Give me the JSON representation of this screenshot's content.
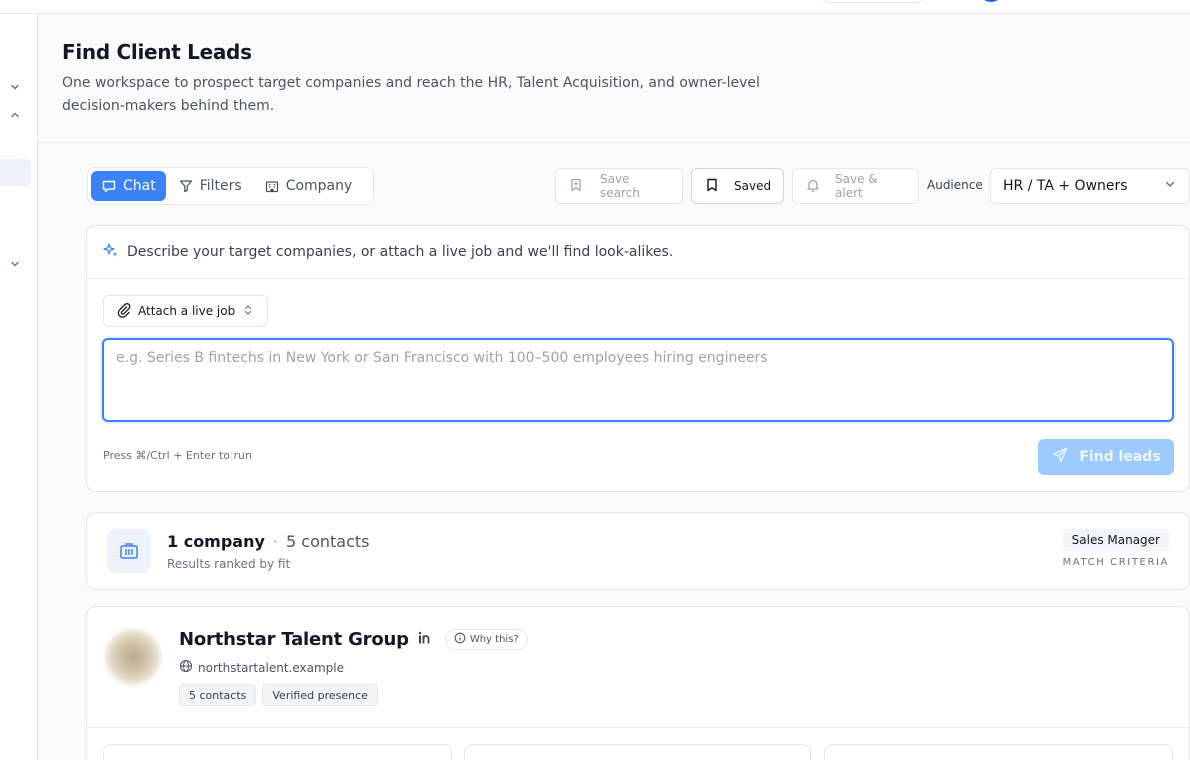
{
  "header": {
    "title": "Find Client Leads",
    "subtitle": "One workspace to prospect target companies and reach the HR, Talent Acquisition, and owner-level decision-makers behind them."
  },
  "mode_tabs": [
    {
      "label": "Chat",
      "icon": "chat-icon",
      "active": true
    },
    {
      "label": "Filters",
      "icon": "filter-icon",
      "active": false
    },
    {
      "label": "Company",
      "icon": "building-icon",
      "active": false
    }
  ],
  "toolbar": {
    "save_search_label": "Save search",
    "saved_label": "Saved",
    "save_alert_label": "Save & alert",
    "audience_label": "Audience",
    "audience_value": "HR / TA + Owners"
  },
  "prompt": {
    "heading": "Describe your target companies, or attach a live job and we'll find look-alikes.",
    "attach_label": "Attach a live job",
    "placeholder": "e.g. Series B fintechs in New York or San Francisco with 100–500 employees hiring engineers",
    "value": "",
    "shortcut_hint": "Press ⌘/Ctrl + Enter to run",
    "submit_label": "Find leads"
  },
  "summary": {
    "companies": "1 company",
    "separator": "·",
    "contacts": "5 contacts",
    "subtitle": "Results ranked by fit",
    "criteria_badge": "Sales Manager",
    "criteria_label": "MATCH CRITERIA"
  },
  "company": {
    "name": "Northstar Talent Group",
    "why_label": "Why this?",
    "domain": "northstartalent.example",
    "tags": [
      "5 contacts",
      "Verified presence"
    ]
  },
  "colors": {
    "accent": "#3b82f6",
    "accent_disabled": "#93c5fd",
    "border": "#e5e7eb"
  }
}
